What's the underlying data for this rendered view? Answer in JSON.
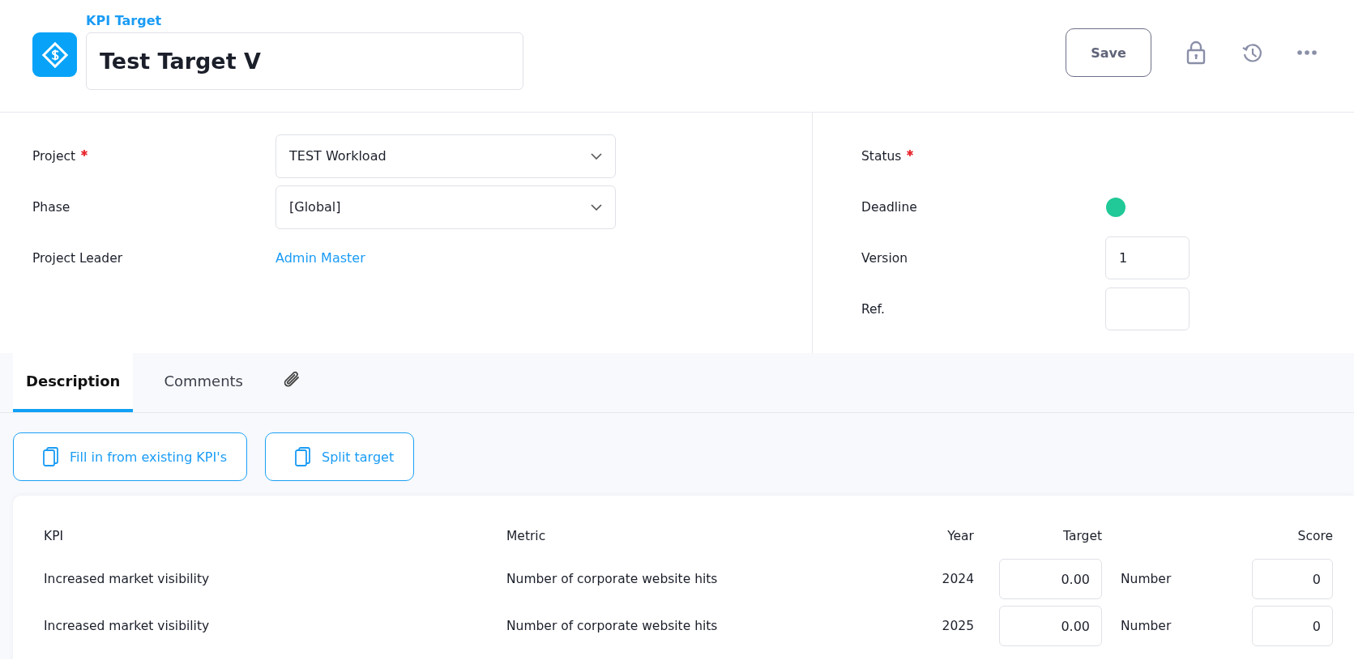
{
  "header": {
    "record_type": "KPI Target",
    "title": "Test Target V",
    "save": "Save"
  },
  "form": {
    "left": [
      {
        "kind": "select",
        "label": "Project",
        "required": true,
        "value": "TEST Workload"
      },
      {
        "kind": "select",
        "label": "Phase",
        "required": false,
        "value": "[Global]"
      },
      {
        "kind": "link",
        "label": "Project Leader",
        "required": false,
        "value": "Admin Master"
      }
    ],
    "right": [
      {
        "kind": "empty",
        "label": "Status",
        "required": true
      },
      {
        "kind": "dot",
        "label": "Deadline",
        "required": false,
        "color": "#20c997"
      },
      {
        "kind": "input",
        "label": "Version",
        "required": false,
        "value": "1"
      },
      {
        "kind": "input",
        "label": "Ref.",
        "required": false
      }
    ]
  },
  "tabs": [
    {
      "kind": "text",
      "label": "Description",
      "selected": true
    },
    {
      "kind": "text",
      "label": "Comments",
      "selected": false
    },
    {
      "kind": "attachment",
      "selected": false
    }
  ],
  "actions": [
    "Fill in from existing KPI's",
    "Split target"
  ],
  "table": {
    "columns": [
      "KPI",
      "Metric",
      "Year",
      "Target",
      "Score"
    ],
    "rows": [
      {
        "kpi": "Increased market visibility",
        "metric": "Number of corporate website hits",
        "year": "2024",
        "target": "0.00",
        "unit": "Number",
        "score": "0"
      },
      {
        "kpi": "Increased market visibility",
        "metric": "Number of corporate website hits",
        "year": "2025",
        "target": "0.00",
        "unit": "Number",
        "score": "0"
      }
    ]
  }
}
